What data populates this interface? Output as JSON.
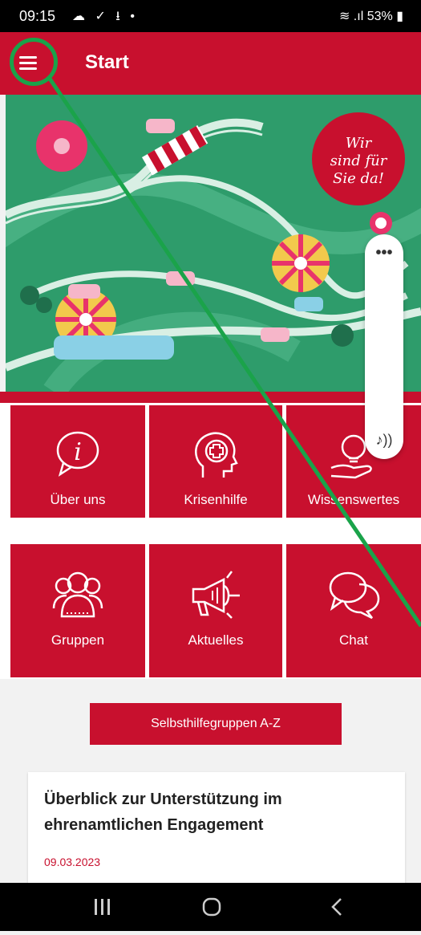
{
  "status_bar": {
    "time": "09:15",
    "icons_left": "☁ ✓ ⭳ •",
    "battery": "53%"
  },
  "app_bar": {
    "title": "Start"
  },
  "hero": {
    "speech_bubble": [
      "Wir",
      "sind für",
      "Sie da!"
    ]
  },
  "tiles": [
    {
      "label": "Über uns",
      "icon": "info-speech-icon"
    },
    {
      "label": "Krisenhilfe",
      "icon": "head-cross-icon"
    },
    {
      "label": "Wissenswertes",
      "icon": "lightbulb-hand-icon"
    },
    {
      "label": "Gruppen",
      "icon": "people-group-icon"
    },
    {
      "label": "Aktuelles",
      "icon": "megaphone-icon"
    },
    {
      "label": "Chat",
      "icon": "chat-bubbles-icon"
    }
  ],
  "primary_button": {
    "label": "Selbsthilfegruppen A-Z"
  },
  "news_card": {
    "title": "Überblick zur Unterstützung im ehrenamtlichen Engagement",
    "date": "09.03.2023"
  },
  "floating_panel": {
    "menu": "•••",
    "sound": "♪))"
  },
  "colors": {
    "brand_red": "#c8102e",
    "hero_green": "#2e9c6b",
    "annotation_green": "#1aa34a"
  }
}
